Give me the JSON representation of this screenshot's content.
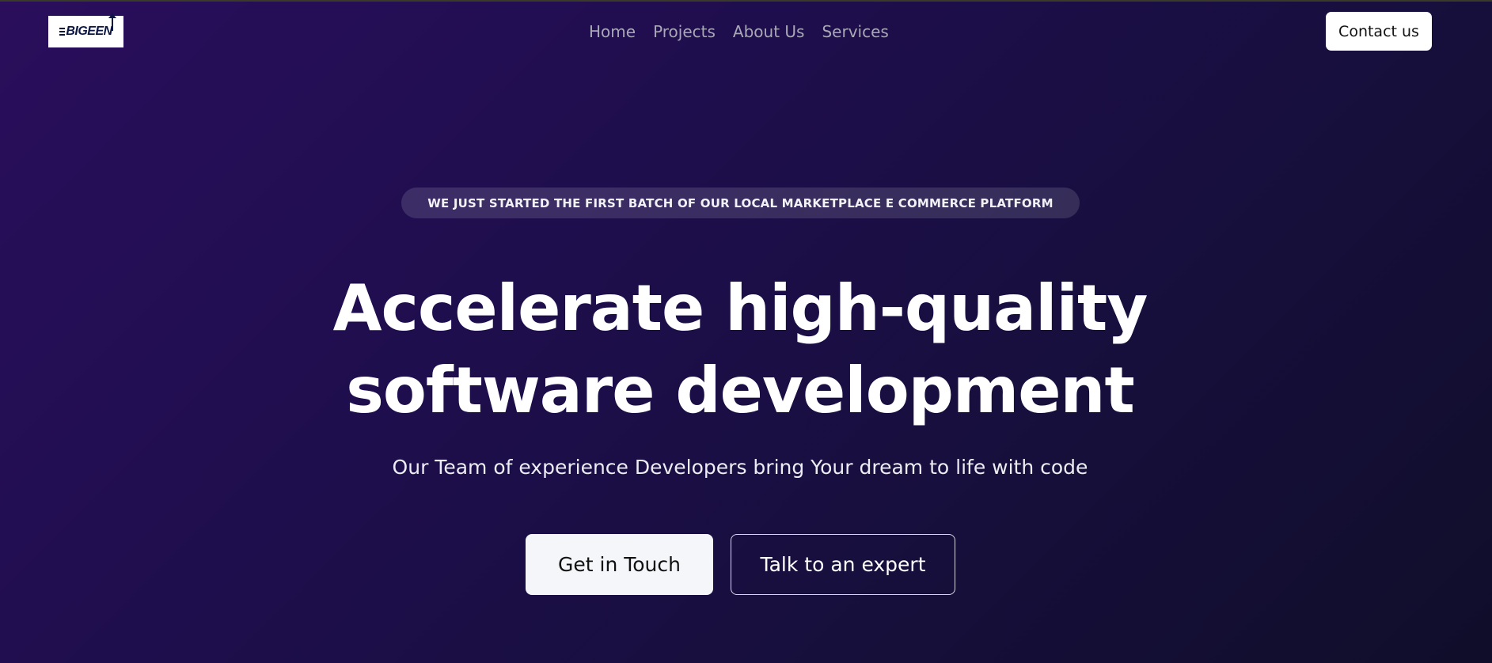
{
  "brand": {
    "logo_text": "BIGEEN"
  },
  "nav": {
    "links": [
      "Home",
      "Projects",
      "About Us",
      "Services"
    ],
    "contact_label": "Contact us"
  },
  "hero": {
    "announcement": "WE JUST STARTED THE FIRST BATCH OF OUR LOCAL MARKETPLACE E COMMERCE PLATFORM",
    "headline_line1": "Accelerate high-quality",
    "headline_line2": "software development",
    "subtitle": "Our Team of experience Developers bring Your dream to life with code",
    "primary_cta": "Get in Touch",
    "secondary_cta": "Talk to an expert"
  },
  "colors": {
    "background_start": "#2a0e5c",
    "background_end": "#100d2a",
    "nav_link": "#a9a8b6",
    "button_light": "#f4f6fa"
  }
}
